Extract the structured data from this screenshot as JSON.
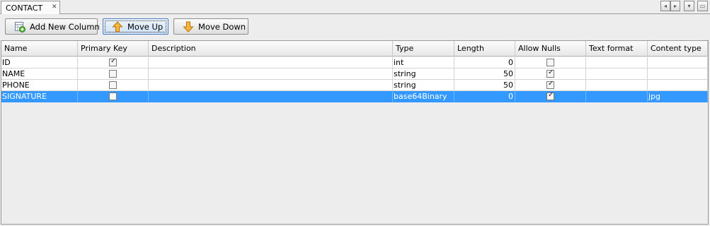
{
  "tab": {
    "title": "CONTACT",
    "close_glyph": "✕"
  },
  "tab_nav": {
    "prev": "◂",
    "next": "▸",
    "menu": "▾",
    "restore": "▭"
  },
  "toolbar": {
    "add_label": "Add New Column",
    "up_label": "Move Up",
    "down_label": "Move Down"
  },
  "columns": [
    "Name",
    "Primary Key",
    "Description",
    "Type",
    "Length",
    "Allow Nulls",
    "Text format",
    "Content type"
  ],
  "rows": [
    {
      "name": "ID",
      "primary_key": true,
      "description": "",
      "type": "int",
      "length": "0",
      "allow_nulls": false,
      "text_format": "",
      "content_type": ""
    },
    {
      "name": "NAME",
      "primary_key": false,
      "description": "",
      "type": "string",
      "length": "50",
      "allow_nulls": true,
      "text_format": "",
      "content_type": ""
    },
    {
      "name": "PHONE",
      "primary_key": false,
      "description": "",
      "type": "string",
      "length": "50",
      "allow_nulls": true,
      "text_format": "",
      "content_type": ""
    },
    {
      "name": "SIGNATURE",
      "primary_key": false,
      "description": "",
      "type": "base64Binary",
      "length": "0",
      "allow_nulls": true,
      "text_format": "",
      "content_type": "jpg"
    }
  ],
  "selected_row": 3,
  "colors": {
    "selection": "#3399ff",
    "arrow": "#f0a020"
  },
  "icons": {
    "add": "add-column-icon",
    "up": "arrow-up-icon",
    "down": "arrow-down-icon"
  }
}
